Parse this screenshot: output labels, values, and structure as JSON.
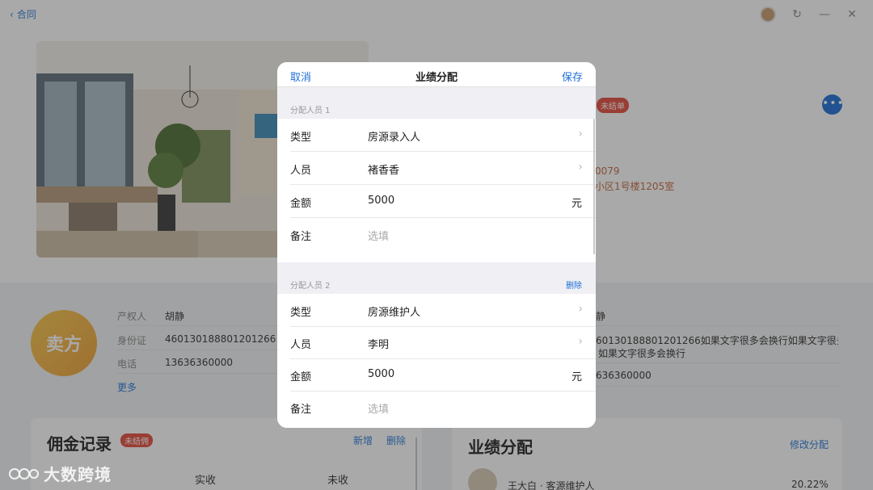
{
  "topbar": {
    "back_label": "合同"
  },
  "status_badge": "未结单",
  "info_lines": [
    "0079",
    "小区1号楼1205室"
  ],
  "seller": {
    "circle_label": "卖方",
    "owner_label": "产权人",
    "owner_name": "胡静",
    "id_label": "身份证",
    "id_value": "460130188801201266",
    "phone_label": "电话",
    "phone_value": "13636360000",
    "more_link": "更多"
  },
  "buyer": {
    "name": "静",
    "id_value": "60130188801201266如果文字很多会换行如果文字很多会换",
    "id_value_line2": "如果文字很多会换行",
    "phone_value": "636360000"
  },
  "commission_card": {
    "title": "佣金记录",
    "badge": "未结佣",
    "add_label": "新增",
    "delete_label": "删除",
    "col_actual": "实收",
    "col_unpaid": "未收"
  },
  "performance_card": {
    "title": "业绩分配",
    "edit_label": "修改分配",
    "person_line": "王大白 · 客源维护人",
    "percent": "20.22%"
  },
  "modal": {
    "cancel_label": "取消",
    "title": "业绩分配",
    "save_label": "保存",
    "groups": [
      {
        "label": "分配人员 1",
        "type_label": "类型",
        "type_value": "房源录入人",
        "person_label": "人员",
        "person_value": "褚香香",
        "amount_label": "金额",
        "amount_value": "5000",
        "unit": "元",
        "note_label": "备注",
        "note_placeholder": "选填"
      },
      {
        "label": "分配人员 2",
        "delete_label": "删除",
        "type_label": "类型",
        "type_value": "房源维护人",
        "person_label": "人员",
        "person_value": "李明",
        "amount_label": "金额",
        "amount_value": "5000",
        "unit": "元",
        "note_label": "备注",
        "note_placeholder": "选填"
      }
    ]
  },
  "watermark": "大数跨境",
  "colors": {
    "accent": "#1f6fd6",
    "danger": "#e74c3c",
    "seller_gold": "#f5c64a"
  }
}
